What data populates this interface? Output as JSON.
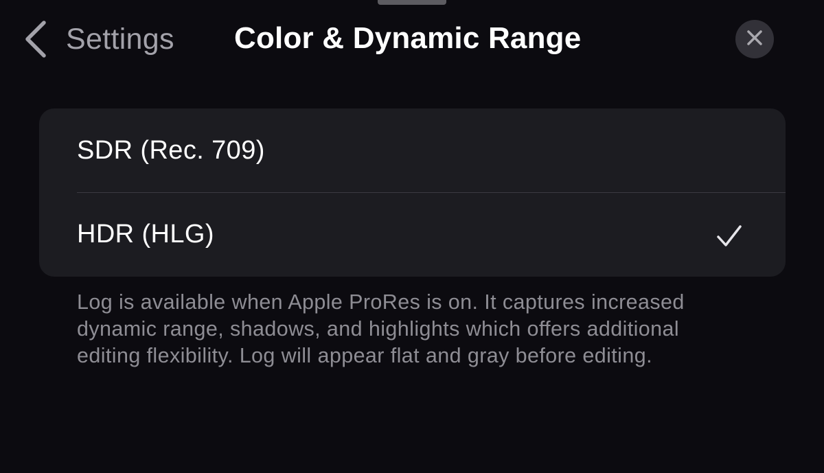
{
  "nav": {
    "back_label": "Settings",
    "title": "Color & Dynamic Range",
    "back_icon": "chevron-left-icon",
    "close_icon": "close-icon"
  },
  "options": [
    {
      "label": "SDR (Rec. 709)",
      "selected": false
    },
    {
      "label": "HDR (HLG)",
      "selected": true
    }
  ],
  "footer": {
    "note": "Log is available when Apple ProRes is on. It captures increased dynamic range, shadows, and highlights which offers additional editing flexibility. Log will appear flat and gray before editing."
  },
  "colors": {
    "background": "#0c0b10",
    "card": "#1c1c21",
    "secondary_text": "#8e8d94",
    "close_button_bg": "#323138"
  }
}
